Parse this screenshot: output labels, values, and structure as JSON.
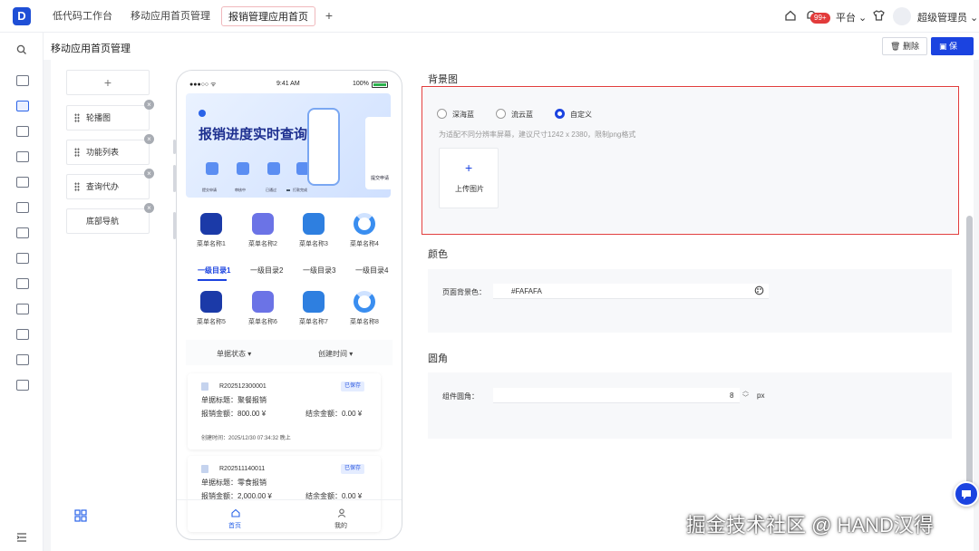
{
  "app": {
    "logo_letter": "D"
  },
  "tabs": [
    {
      "label": "低代码工作台"
    },
    {
      "label": "移动应用首页管理"
    },
    {
      "label": "报销管理应用首页"
    }
  ],
  "topbar": {
    "badge": "99+",
    "platform": "平台",
    "user": "超级管理员"
  },
  "page": {
    "title": "移动应用首页管理",
    "delete_label": "删除",
    "save_label": "保存"
  },
  "components": {
    "add": "+",
    "items": [
      {
        "label": "轮播图"
      },
      {
        "label": "功能列表"
      },
      {
        "label": "查询代办"
      },
      {
        "label": "底部导航"
      }
    ]
  },
  "phone": {
    "time": "9:41 AM",
    "battery": "100%",
    "banner": {
      "title": "报销进度实时查询",
      "flow": [
        "提交申请",
        "审核中",
        "已通过",
        "打款完成"
      ],
      "side_label": "提交申请"
    },
    "menu_row1": [
      "菜单名称1",
      "菜单名称2",
      "菜单名称3",
      "菜单名称4"
    ],
    "menu_row2": [
      "菜单名称5",
      "菜单名称6",
      "菜单名称7",
      "菜单名称8"
    ],
    "categories": [
      "一级目录1",
      "一级目录2",
      "一级目录3",
      "一级目录4"
    ],
    "filters": [
      "单据状态",
      "创建时间"
    ],
    "cards": [
      {
        "no": "R202512300001",
        "tag": "已保存",
        "title_label": "单据标题：",
        "title": "聚餐报销",
        "amount_label": "报销金额：",
        "amount": "800.00 ¥",
        "balance_label": "结余金额：",
        "balance": "0.00 ¥",
        "created": "创建时间：2025/12/30 07:34:32 晚上"
      },
      {
        "no": "R202511140011",
        "tag": "已保存",
        "title_label": "单据标题：",
        "title": "零食报销",
        "amount_label": "报销金额：",
        "amount": "2,000.00 ¥",
        "balance_label": "结余金额：",
        "balance": "0.00 ¥",
        "created": ""
      }
    ],
    "nav": [
      "首页",
      "我的"
    ]
  },
  "settings": {
    "bg": {
      "title": "背景图",
      "options": [
        "深海蓝",
        "流云蓝",
        "自定义"
      ],
      "selected": "自定义",
      "hint": "为适配不同分辨率屏幕，建议尺寸1242 x 2380，限制png格式",
      "upload_label": "上传图片"
    },
    "color": {
      "title": "颜色",
      "label": "页面背景色：",
      "value": "#FAFAFA"
    },
    "radius": {
      "title": "圆角",
      "label": "组件圆角：",
      "value": "8",
      "unit": "px"
    }
  },
  "watermark": "掘金技术社区 @ HAND汉得",
  "colors": {
    "accent": "#1B43E0",
    "highlight": "#E03C3C"
  }
}
